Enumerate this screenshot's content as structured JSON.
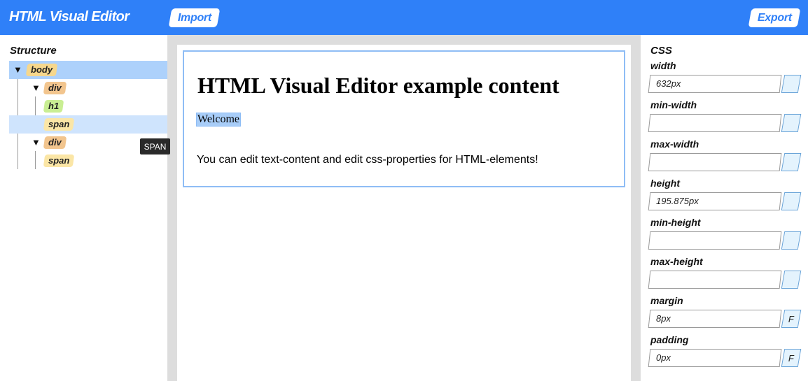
{
  "header": {
    "title": "HTML Visual Editor",
    "import_label": "Import",
    "export_label": "Export"
  },
  "structure": {
    "title": "Structure",
    "tooltip": "SPAN",
    "nodes": [
      {
        "tag": "body",
        "toggle": "▼",
        "selected": "strong"
      },
      {
        "tag": "div",
        "toggle": "▼"
      },
      {
        "tag": "h1"
      },
      {
        "tag": "span",
        "selected": "light"
      },
      {
        "tag": "div",
        "toggle": "▼"
      },
      {
        "tag": "span"
      }
    ]
  },
  "canvas": {
    "heading": "HTML Visual Editor example content",
    "welcome": "Welcome",
    "paragraph": "You can edit text-content and edit css-properties for HTML-elements!"
  },
  "css_panel": {
    "title": "CSS",
    "properties": [
      {
        "label": "width",
        "value": "632px",
        "button": ""
      },
      {
        "label": "min-width",
        "value": "",
        "button": ""
      },
      {
        "label": "max-width",
        "value": "",
        "button": ""
      },
      {
        "label": "height",
        "value": "195.875px",
        "button": ""
      },
      {
        "label": "min-height",
        "value": "",
        "button": ""
      },
      {
        "label": "max-height",
        "value": "",
        "button": ""
      },
      {
        "label": "margin",
        "value": "8px",
        "button": "F"
      },
      {
        "label": "padding",
        "value": "0px",
        "button": "F"
      }
    ]
  },
  "colors": {
    "header_bg": "#2f80f8",
    "selection_strong": "#add1fb",
    "selection_light": "#cfe4fd",
    "tag_body": "#f6d78c",
    "tag_div": "#f2c58e",
    "tag_h1": "#c9ee93",
    "tag_span": "#fbe6a6"
  }
}
